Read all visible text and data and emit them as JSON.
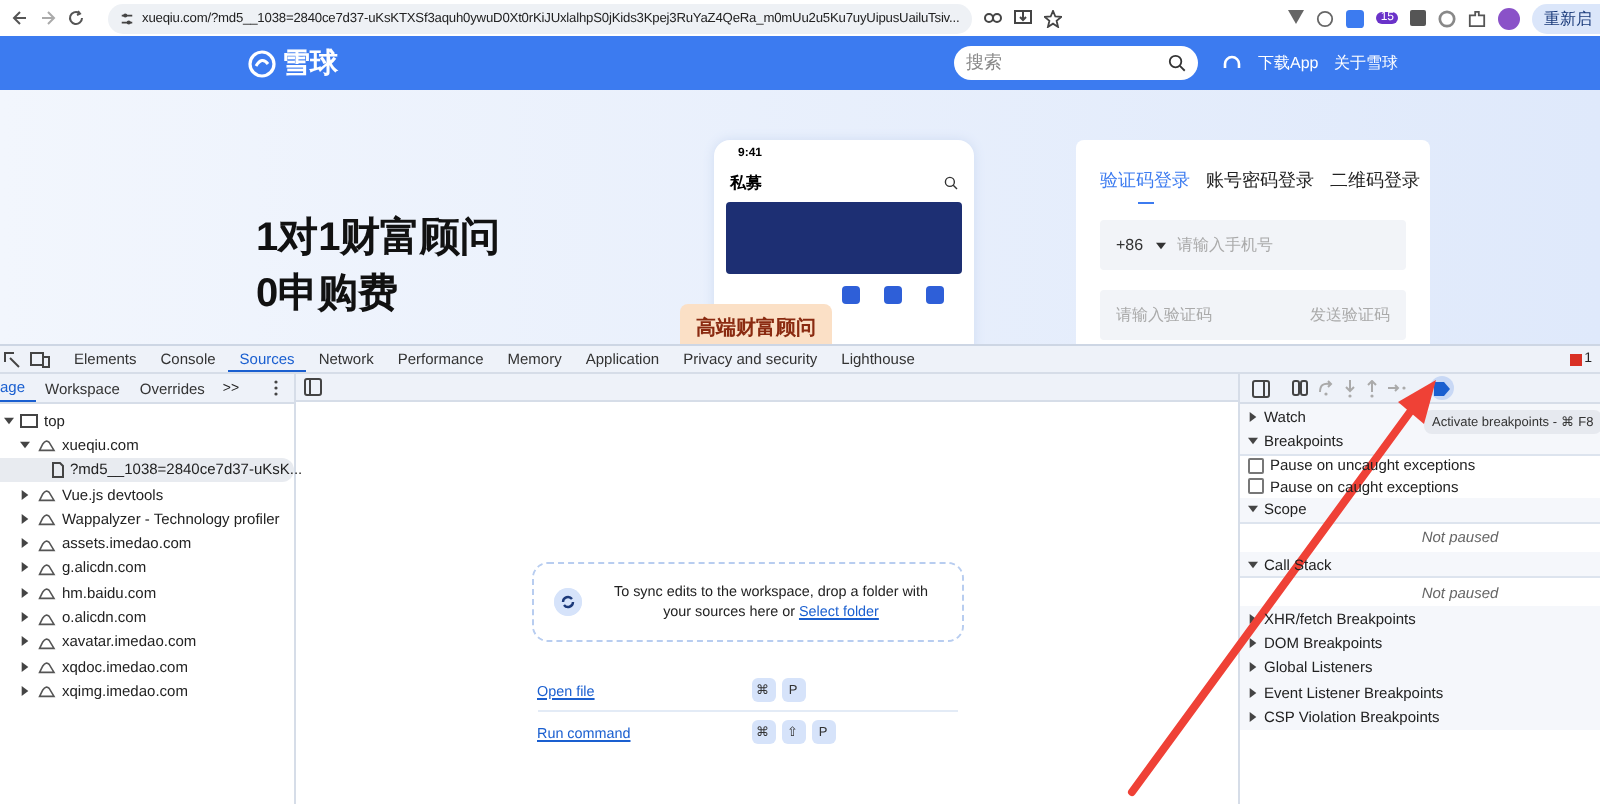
{
  "browser": {
    "url": "xueqiu.com/?md5__1038=2840ce7d37-uKsKTXSf3aquh0ywuD0Xt0rKiJUxlalhpS0jKids3Kpej3RuYaZ4QeRa_m0mUu2u5Ku7uyUipusUailuTsiv...",
    "extension_badge": "15",
    "relaunch": "重新启"
  },
  "site": {
    "logo": "雪球",
    "search_placeholder": "搜索",
    "links": [
      "下载App",
      "关于雪球"
    ],
    "hero": {
      "title": "1对1财富顾问",
      "subtitle": "0申购费"
    },
    "phone": {
      "time": "9:41",
      "title": "私募",
      "badge": "高端财富顾问"
    },
    "login": {
      "tabs": [
        {
          "label": "验证码登录",
          "selected": true
        },
        {
          "label": "账号密码登录",
          "selected": false
        },
        {
          "label": "二维码登录",
          "selected": false
        }
      ],
      "country_code": "+86",
      "phone_placeholder": "请输入手机号",
      "code_placeholder": "请输入验证码",
      "send_code": "发送验证码"
    }
  },
  "devtools": {
    "tabs": [
      {
        "label": "Elements",
        "selected": false
      },
      {
        "label": "Console",
        "selected": false
      },
      {
        "label": "Sources",
        "selected": true
      },
      {
        "label": "Network",
        "selected": false
      },
      {
        "label": "Performance",
        "selected": false
      },
      {
        "label": "Memory",
        "selected": false
      },
      {
        "label": "Application",
        "selected": false
      },
      {
        "label": "Privacy and security",
        "selected": false
      },
      {
        "label": "Lighthouse",
        "selected": false
      }
    ],
    "issues_count": "1",
    "navigator_tabs": [
      {
        "label": "age",
        "selected": true
      },
      {
        "label": "Workspace",
        "selected": false
      },
      {
        "label": "Overrides",
        "selected": false
      }
    ],
    "more_tabs": ">>",
    "tree": [
      {
        "label": "top",
        "kind": "frame",
        "expanded": true,
        "selected": false,
        "children": [
          {
            "label": "xueqiu.com",
            "kind": "origin",
            "expanded": true,
            "selected": false,
            "children": [
              {
                "label": "?md5__1038=2840ce7d37-uKsK...",
                "kind": "file",
                "selected": true
              }
            ]
          },
          {
            "label": "Vue.js devtools",
            "kind": "origin",
            "expanded": false,
            "selected": false
          },
          {
            "label": "Wappalyzer - Technology profiler",
            "kind": "origin",
            "expanded": false,
            "selected": false
          },
          {
            "label": "assets.imedao.com",
            "kind": "origin",
            "expanded": false,
            "selected": false
          },
          {
            "label": "g.alicdn.com",
            "kind": "origin",
            "expanded": false,
            "selected": false
          },
          {
            "label": "hm.baidu.com",
            "kind": "origin",
            "expanded": false,
            "selected": false
          },
          {
            "label": "o.alicdn.com",
            "kind": "origin",
            "expanded": false,
            "selected": false
          },
          {
            "label": "xavatar.imedao.com",
            "kind": "origin",
            "expanded": false,
            "selected": false
          },
          {
            "label": "xqdoc.imedao.com",
            "kind": "origin",
            "expanded": false,
            "selected": false
          },
          {
            "label": "xqimg.imedao.com",
            "kind": "origin",
            "expanded": false,
            "selected": false
          }
        ]
      }
    ],
    "workspace": {
      "message": "To sync edits to the workspace, drop a folder with your sources here or",
      "link": "Select folder"
    },
    "shortcuts": [
      {
        "label": "Open file",
        "keys": [
          "⌘",
          "P"
        ]
      },
      {
        "label": "Run command",
        "keys": [
          "⌘",
          "⇧",
          "P"
        ]
      }
    ],
    "tooltip": "Activate breakpoints - ⌘ F8",
    "sections": [
      {
        "title": "Watch",
        "expanded": false
      },
      {
        "title": "Breakpoints",
        "expanded": true,
        "options": [
          {
            "label": "Pause on uncaught exceptions",
            "checked": false
          },
          {
            "label": "Pause on caught exceptions",
            "checked": false
          }
        ]
      },
      {
        "title": "Scope",
        "expanded": true,
        "note": "Not paused"
      },
      {
        "title": "Call Stack",
        "expanded": true,
        "note": "Not paused"
      },
      {
        "title": "XHR/fetch Breakpoints",
        "expanded": false
      },
      {
        "title": "DOM Breakpoints",
        "expanded": false
      },
      {
        "title": "Global Listeners",
        "expanded": false
      },
      {
        "title": "Event Listener Breakpoints",
        "expanded": false
      },
      {
        "title": "CSP Violation Breakpoints",
        "expanded": false
      }
    ]
  }
}
